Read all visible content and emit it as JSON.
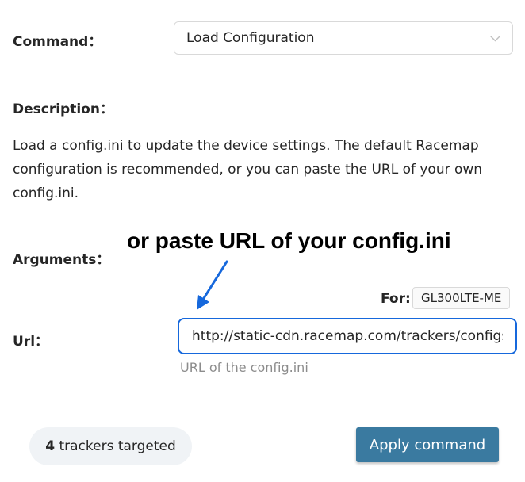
{
  "command": {
    "label": "Command：",
    "selected": "Load Configuration"
  },
  "description": {
    "label": "Description：",
    "text": "Load a config.ini to update the device settings. The default Racemap configuration is recommended, or you can paste the URL of your own config.ini."
  },
  "arguments": {
    "label": "Arguments：",
    "annotation": "or paste URL of your config.ini",
    "for_label": "For:",
    "device": "GL300LTE-ME",
    "url_label": "Url：",
    "url_value": "http://static-cdn.racemap.com/trackers/configs/",
    "url_help": "URL of the config.ini"
  },
  "footer": {
    "tracker_count": "4",
    "tracker_suffix": " trackers targeted",
    "apply_label": "Apply command"
  },
  "colors": {
    "input_focus_border": "#1668dc",
    "annotation_arrow": "#1668dc",
    "apply_button_bg": "#3a7aa0",
    "pill_bg": "#f0f3f6"
  },
  "icons": {
    "select_arrow": "chevron-down-icon",
    "annotation_arrow": "arrow-down-left-icon"
  }
}
